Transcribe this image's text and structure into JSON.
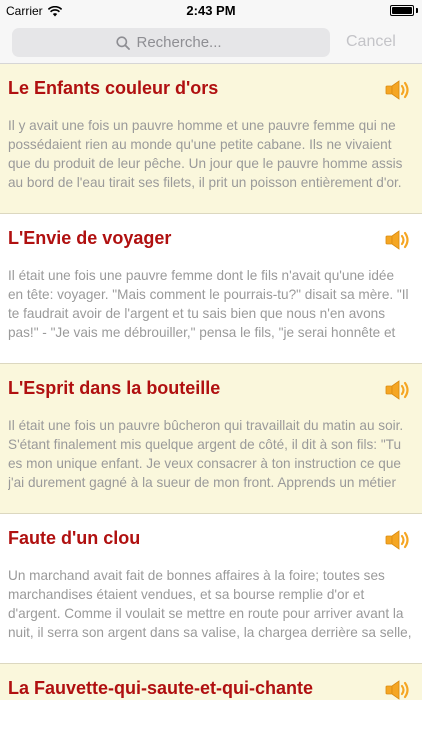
{
  "status": {
    "carrier": "Carrier",
    "time": "2:43 PM"
  },
  "search": {
    "placeholder": "Recherche...",
    "cancel_label": "Cancel"
  },
  "stories": [
    {
      "title": "Le Enfants couleur d'ors",
      "excerpt": "Il y avait une fois un pauvre homme et une pauvre femme qui ne possédaient rien au monde qu'une petite cabane. Ils ne vivaient que du produit de leur pêche. Un jour que le pauvre homme assis au bord de l'eau tirait ses filets, il prit un poisson entièrement d'or. Tandis qu'il contemplait ce..."
    },
    {
      "title": "L'Envie de voyager",
      "excerpt": "Il était une fois une pauvre femme dont le fils n'avait qu'une idée en tête: voyager. \"Mais comment le pourrais-tu?\" disait sa mère. \"Il te faudrait avoir de l'argent et tu sais bien que nous n'en avons pas!\" - \"Je vais me débrouiller,\" pensa le fils, \"je serai honnête et partout je..."
    },
    {
      "title": "L'Esprit dans la bouteille",
      "excerpt": "Il était une fois un pauvre bûcheron qui travaillait du matin au soir. S'étant finalement mis quelque argent de côté, il dit à son fils: \"Tu es mon unique enfant. Je veux consacrer à ton instruction ce que j'ai durement gagné à la sueur de mon front. Apprends un métier honnête et tu..."
    },
    {
      "title": "Faute d'un clou",
      "excerpt": "Un marchand avait fait de bonnes affaires à la foire; toutes ses marchandises étaient vendues, et sa bourse remplie d'or et d'argent. Comme il voulait se mettre en route pour arriver avant la nuit, il serra son argent dans sa valise, la chargea derrière sa selle, et monta à cheval...."
    },
    {
      "title": "La Fauvette-qui-saute-et-qui-chante",
      "excerpt": ""
    }
  ],
  "colors": {
    "title": "#b01010",
    "shaded_row": "#faf7dc",
    "speaker": "#f5a623"
  }
}
